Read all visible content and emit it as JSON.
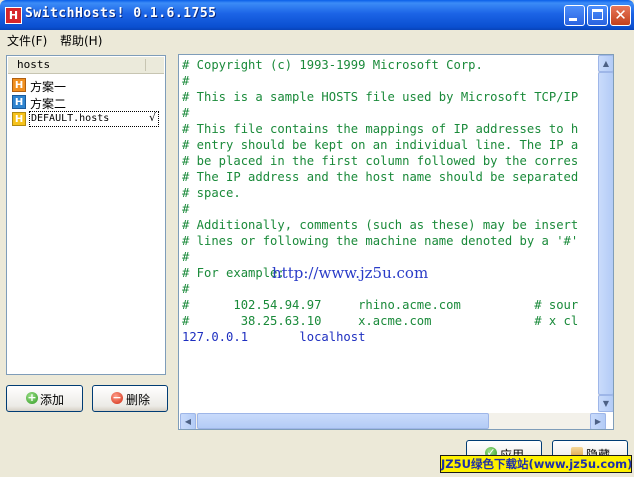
{
  "window": {
    "title": "SwitchHosts! 0.1.6.1755",
    "app_icon_letter": "H"
  },
  "menu": [
    {
      "label": "文件(F)"
    },
    {
      "label": "帮助(H)"
    }
  ],
  "hostlist": {
    "header": "hosts",
    "items": [
      {
        "label": "方案一",
        "icon": "orange-h-icon"
      },
      {
        "label": "方案二",
        "icon": "blue-h-icon"
      },
      {
        "label": "DEFAULT.hosts",
        "icon": "yellow-h-icon",
        "selected": true,
        "check": "√"
      }
    ]
  },
  "buttons": {
    "add": "添加",
    "delete": "删除",
    "apply": "应用",
    "hide": "隐藏"
  },
  "editor": {
    "lines": [
      "# Copyright (c) 1993-1999 Microsoft Corp.",
      "#",
      "# This is a sample HOSTS file used by Microsoft TCP/IP",
      "#",
      "# This file contains the mappings of IP addresses to h",
      "# entry should be kept on an individual line. The IP a",
      "# be placed in the first column followed by the corres",
      "# The IP address and the host name should be separated",
      "# space.",
      "#",
      "# Additionally, comments (such as these) may be insert",
      "# lines or following the machine name denoted by a '#'",
      "#",
      "# For example:",
      "#",
      "#      102.54.94.97     rhino.acme.com          # sour",
      "#       38.25.63.10     x.acme.com              # x cl",
      "127.0.0.1       localhost"
    ]
  },
  "watermark": {
    "url": "http://www.jz5u.com",
    "banner": "JZ5U绿色下载站(www.jz5u.com)"
  },
  "colors": {
    "titlebar": "#0A4FD0",
    "comment": "#1A8A3A",
    "entry": "#1E2FC0",
    "banner_bg": "#FFF200"
  }
}
